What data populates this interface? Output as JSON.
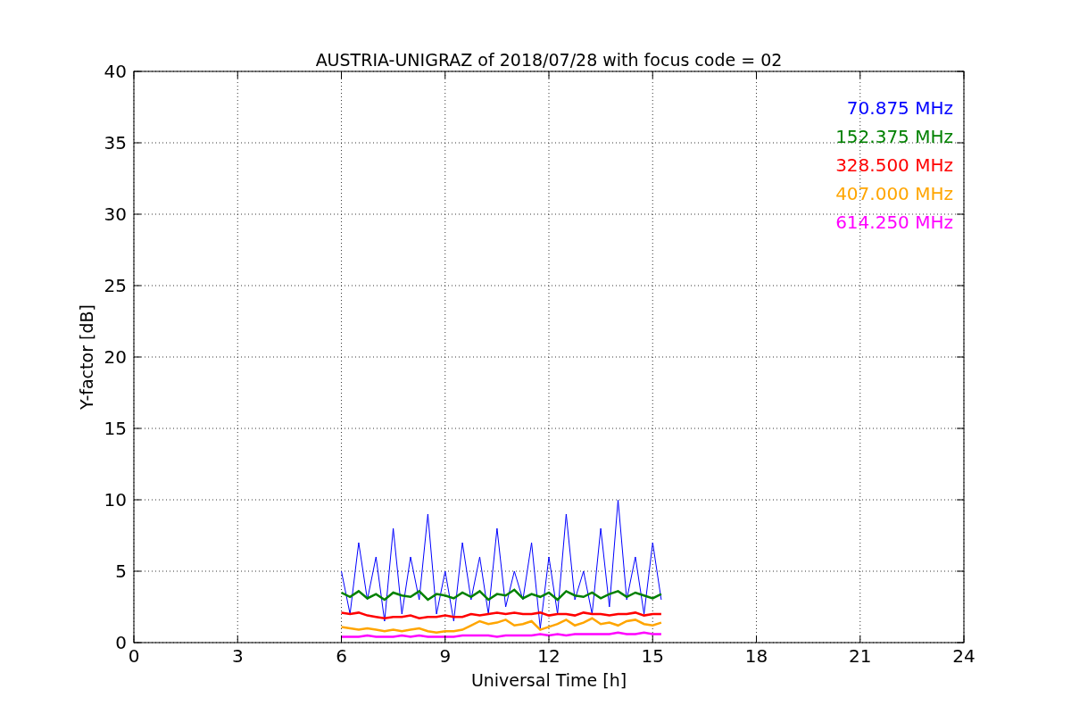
{
  "chart_data": {
    "type": "line",
    "title": "AUSTRIA-UNIGRAZ of 2018/07/28 with focus code = 02",
    "xlabel": "Universal Time [h]",
    "ylabel": "Y-factor [dB]",
    "x": [
      6,
      6.25,
      6.5,
      6.75,
      7,
      7.25,
      7.5,
      7.75,
      8,
      8.25,
      8.5,
      8.75,
      9,
      9.25,
      9.5,
      9.75,
      10,
      10.25,
      10.5,
      10.75,
      11,
      11.25,
      11.5,
      11.75,
      12,
      12.25,
      12.5,
      12.75,
      13,
      13.25,
      13.5,
      13.75,
      14,
      14.25,
      14.5,
      14.75,
      15,
      15.25
    ],
    "series": [
      {
        "name": "70.875 MHz",
        "color": "#0000ff",
        "values": [
          5,
          2,
          7,
          3,
          6,
          1.5,
          8,
          2,
          6,
          3,
          9,
          2,
          5,
          1.5,
          7,
          3,
          6,
          2,
          8,
          2.5,
          5,
          3,
          7,
          1,
          6,
          2,
          9,
          3,
          5,
          2,
          8,
          2.5,
          10,
          3,
          6,
          2,
          7,
          3
        ]
      },
      {
        "name": "152.375 MHz",
        "color": "#008000",
        "values": [
          3.5,
          3.2,
          3.6,
          3.1,
          3.4,
          3.0,
          3.5,
          3.3,
          3.2,
          3.6,
          3.0,
          3.4,
          3.3,
          3.1,
          3.5,
          3.2,
          3.6,
          3.0,
          3.4,
          3.3,
          3.7,
          3.1,
          3.4,
          3.2,
          3.5,
          3.0,
          3.6,
          3.3,
          3.2,
          3.5,
          3.1,
          3.4,
          3.6,
          3.2,
          3.5,
          3.3,
          3.1,
          3.4
        ]
      },
      {
        "name": "328.500 MHz",
        "color": "#ff0000",
        "values": [
          2.1,
          2.0,
          2.1,
          1.9,
          1.8,
          1.7,
          1.8,
          1.8,
          1.9,
          1.7,
          1.8,
          1.8,
          1.9,
          1.8,
          1.8,
          2.0,
          1.9,
          2.0,
          2.1,
          2.0,
          2.1,
          2.0,
          2.0,
          2.1,
          1.9,
          2.0,
          2.0,
          1.9,
          2.1,
          2.0,
          2.0,
          1.9,
          2.0,
          2.0,
          2.1,
          1.9,
          2.0,
          2.0
        ]
      },
      {
        "name": "407.000 MHz",
        "color": "#ffa500",
        "values": [
          1.1,
          1.0,
          0.9,
          1.0,
          0.9,
          0.8,
          0.9,
          0.8,
          0.9,
          1.0,
          0.8,
          0.7,
          0.8,
          0.8,
          0.9,
          1.2,
          1.5,
          1.3,
          1.4,
          1.6,
          1.2,
          1.3,
          1.5,
          0.9,
          1.1,
          1.3,
          1.6,
          1.2,
          1.4,
          1.7,
          1.3,
          1.4,
          1.2,
          1.5,
          1.6,
          1.3,
          1.2,
          1.4
        ]
      },
      {
        "name": "614.250 MHz",
        "color": "#ff00ff",
        "values": [
          0.4,
          0.4,
          0.4,
          0.5,
          0.4,
          0.4,
          0.4,
          0.5,
          0.4,
          0.5,
          0.4,
          0.4,
          0.4,
          0.4,
          0.5,
          0.5,
          0.5,
          0.5,
          0.4,
          0.5,
          0.5,
          0.5,
          0.5,
          0.6,
          0.5,
          0.6,
          0.5,
          0.6,
          0.6,
          0.6,
          0.6,
          0.6,
          0.7,
          0.6,
          0.6,
          0.7,
          0.6,
          0.6
        ]
      }
    ],
    "grid": true,
    "xlim": [
      0,
      24
    ],
    "ylim": [
      0,
      40
    ],
    "xticks": [
      0,
      3,
      6,
      9,
      12,
      15,
      18,
      21,
      24
    ],
    "yticks": [
      0,
      5,
      10,
      15,
      20,
      25,
      30,
      35,
      40
    ]
  }
}
